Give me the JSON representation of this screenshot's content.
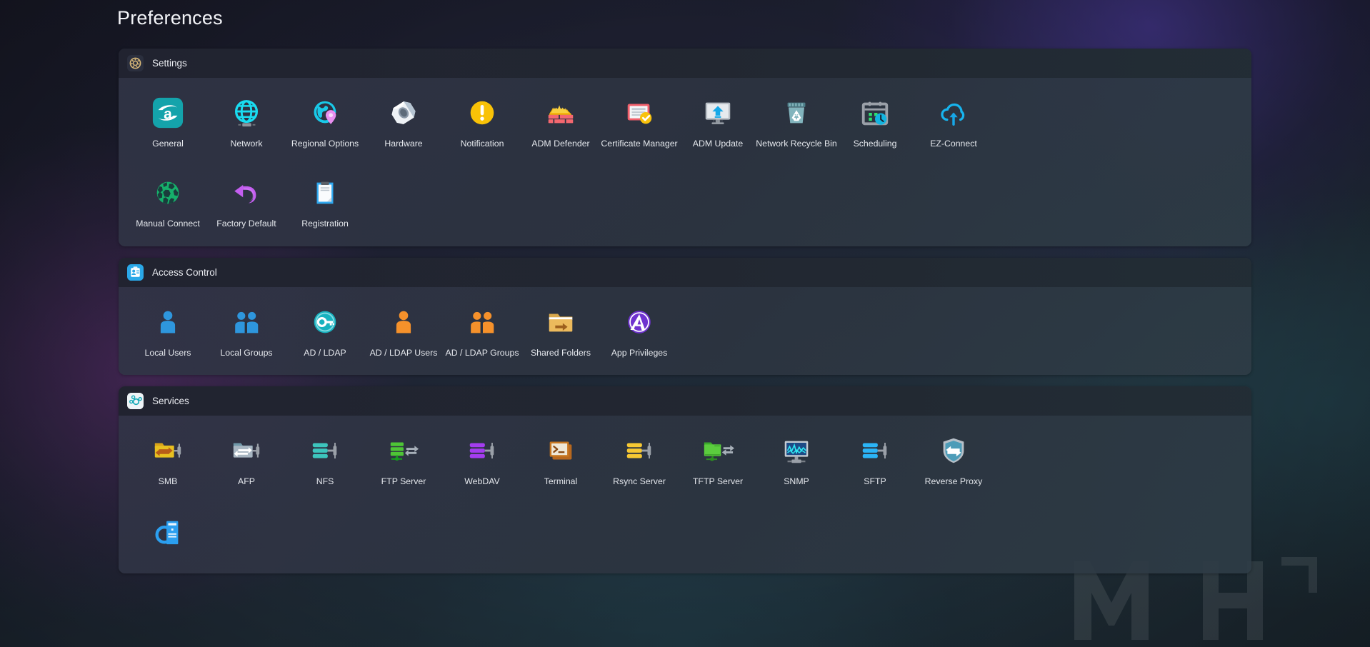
{
  "page": {
    "title": "Preferences"
  },
  "sections": [
    {
      "id": "settings",
      "title": "Settings",
      "header_icon": "gear-icon",
      "items": [
        {
          "label": "General",
          "icon": "asustor-a-logo-icon"
        },
        {
          "label": "Network",
          "icon": "globe-grid-icon"
        },
        {
          "label": "Regional Options",
          "icon": "globe-pin-icon"
        },
        {
          "label": "Hardware",
          "icon": "nut-hardware-icon"
        },
        {
          "label": "Notification",
          "icon": "exclamation-circle-icon"
        },
        {
          "label": "ADM Defender",
          "icon": "firewall-brick-icon"
        },
        {
          "label": "Certificate Manager",
          "icon": "certificate-check-icon"
        },
        {
          "label": "ADM Update",
          "icon": "monitor-upload-icon"
        },
        {
          "label": "Network Recycle Bin",
          "icon": "recycle-bin-icon"
        },
        {
          "label": "Scheduling",
          "icon": "calendar-clock-icon"
        },
        {
          "label": "EZ-Connect",
          "icon": "cloud-upload-icon"
        },
        {
          "label": "Manual Connect",
          "icon": "green-globe-icon"
        },
        {
          "label": "Factory Default",
          "icon": "undo-arrow-icon"
        },
        {
          "label": "Registration",
          "icon": "clipboard-icon"
        }
      ]
    },
    {
      "id": "access-control",
      "title": "Access Control",
      "header_icon": "id-badge-icon",
      "items": [
        {
          "label": "Local Users",
          "icon": "person-blue-icon"
        },
        {
          "label": "Local Groups",
          "icon": "people-blue-icon"
        },
        {
          "label": "AD / LDAP",
          "icon": "key-circle-icon"
        },
        {
          "label": "AD / LDAP Users",
          "icon": "person-orange-icon"
        },
        {
          "label": "AD / LDAP Groups",
          "icon": "people-orange-icon"
        },
        {
          "label": "Shared Folders",
          "icon": "folder-arrow-icon"
        },
        {
          "label": "App Privileges",
          "icon": "app-privileges-a-icon"
        }
      ]
    },
    {
      "id": "services",
      "title": "Services",
      "header_icon": "services-node-icon",
      "items": [
        {
          "label": "SMB",
          "icon": "smb-folder-icon"
        },
        {
          "label": "AFP",
          "icon": "afp-folder-icon"
        },
        {
          "label": "NFS",
          "icon": "nfs-server-icon"
        },
        {
          "label": "FTP Server",
          "icon": "ftp-server-icon"
        },
        {
          "label": "WebDAV",
          "icon": "webdav-server-icon"
        },
        {
          "label": "Terminal",
          "icon": "terminal-icon"
        },
        {
          "label": "Rsync Server",
          "icon": "rsync-server-icon"
        },
        {
          "label": "TFTP Server",
          "icon": "tftp-folder-icon"
        },
        {
          "label": "SNMP",
          "icon": "snmp-monitor-icon"
        },
        {
          "label": "SFTP",
          "icon": "sftp-server-icon"
        },
        {
          "label": "Reverse Proxy",
          "icon": "reverse-proxy-shield-icon"
        },
        {
          "label": "",
          "icon": "web-server-icon"
        }
      ]
    }
  ],
  "colors": {
    "accent_cyan": "#17c4e0",
    "accent_teal": "#16a8b4",
    "warning_yellow": "#f5b81b",
    "danger_red": "#f2616d",
    "orange": "#f58b2c",
    "purple": "#a94ff0",
    "green": "#2eb872",
    "blue": "#2e96dd"
  }
}
